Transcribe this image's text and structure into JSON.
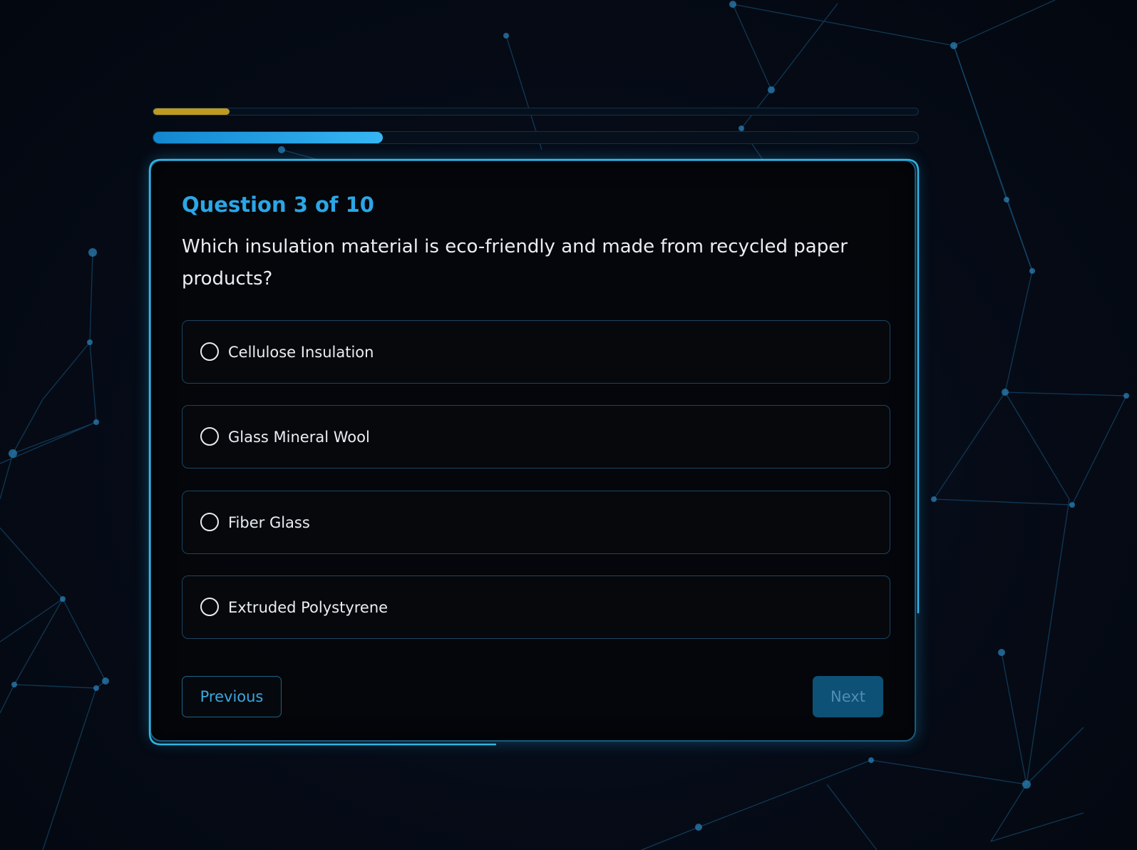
{
  "progress": {
    "timer_fraction": 0.1,
    "quiz_fraction": 0.3,
    "timer_color": "#bf9a1e",
    "quiz_color": "#1e9ee6"
  },
  "quiz": {
    "title": "Question 3 of 10",
    "question": "Which insulation material is eco-friendly and made from recycled paper products?",
    "options": [
      {
        "label": "Cellulose Insulation",
        "selected": false
      },
      {
        "label": "Glass Mineral Wool",
        "selected": false
      },
      {
        "label": "Fiber Glass",
        "selected": false
      },
      {
        "label": "Extruded Polystyrene",
        "selected": false
      }
    ]
  },
  "buttons": {
    "previous": "Previous",
    "next": "Next"
  },
  "colors": {
    "accent": "#2ba6e6",
    "background": "#050a14",
    "card_border": "#1a5a7e"
  }
}
